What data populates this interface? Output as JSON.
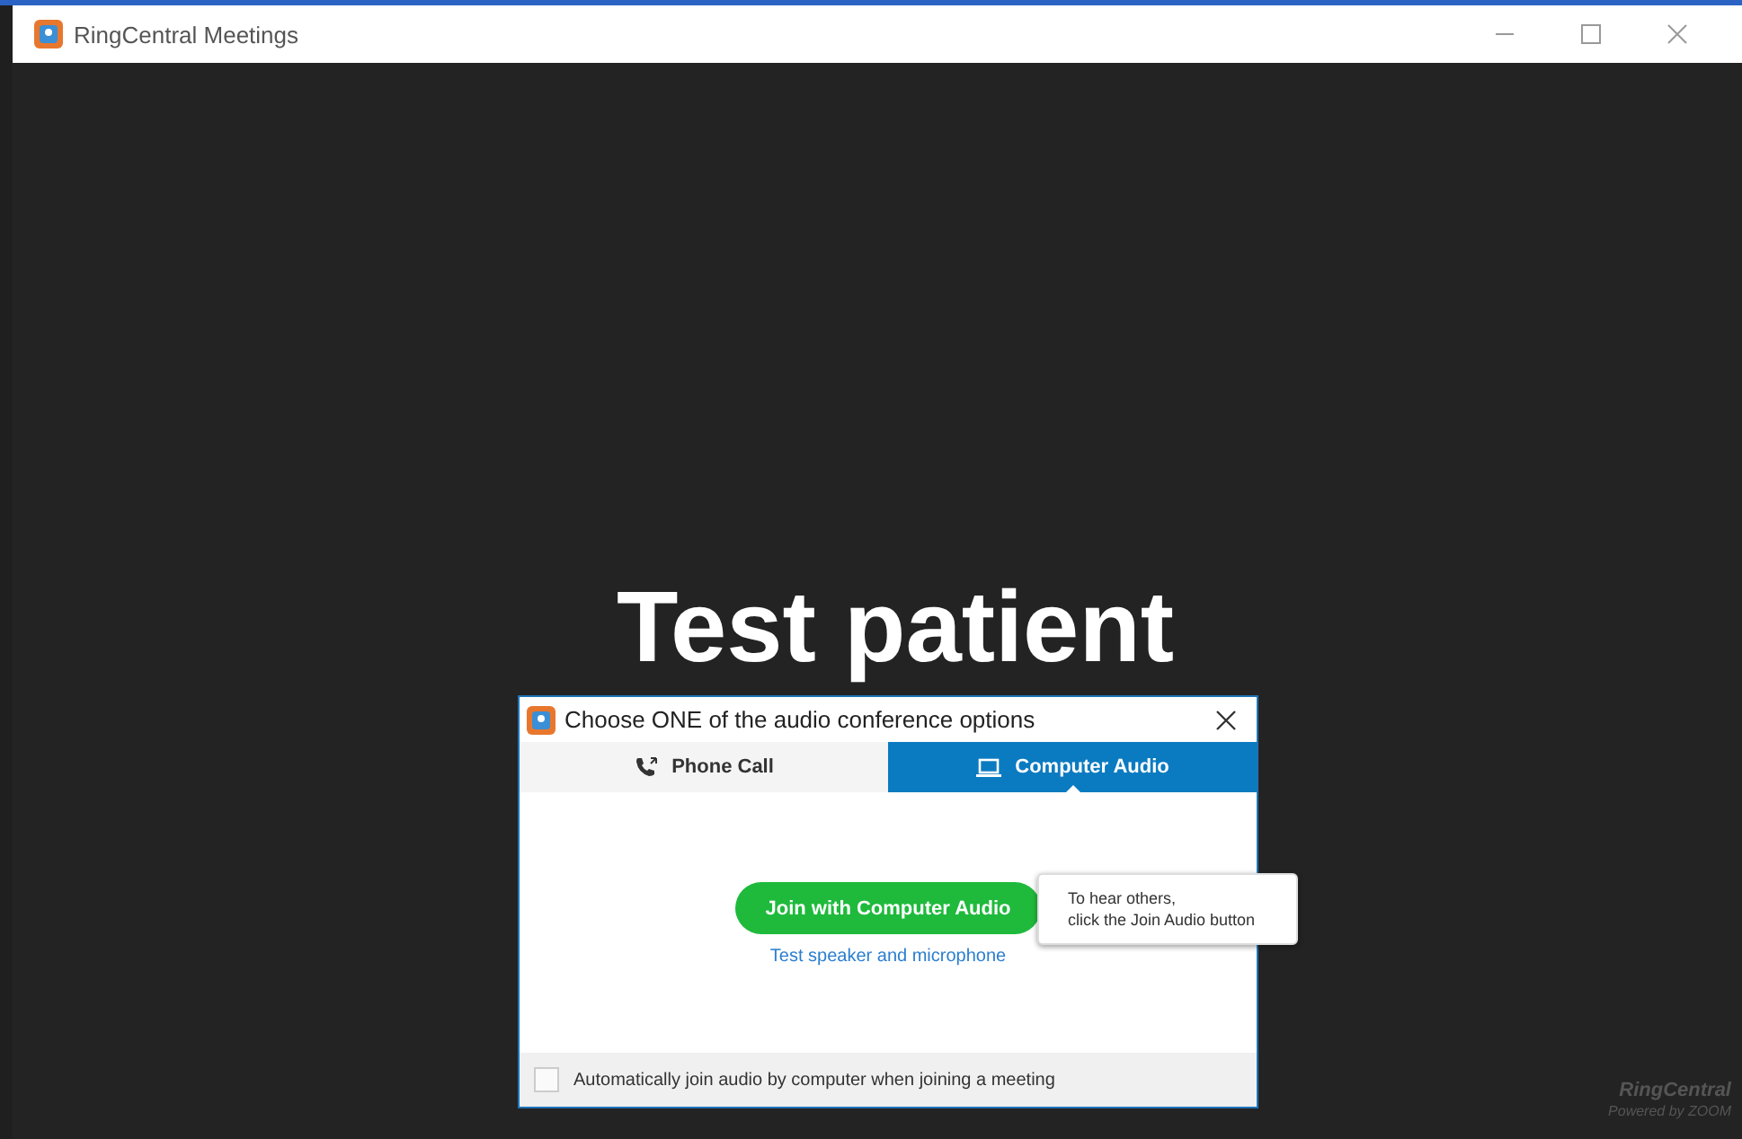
{
  "window": {
    "title": "RingCentral Meetings"
  },
  "meeting": {
    "name": "Test patient"
  },
  "dialog": {
    "title": "Choose ONE of the audio conference options",
    "tabs": [
      {
        "label": "Phone Call",
        "kind": "phone",
        "selected": false
      },
      {
        "label": "Computer Audio",
        "kind": "computer",
        "selected": true
      }
    ],
    "join_button": "Join with Computer Audio",
    "test_link": "Test speaker and microphone",
    "tooltip": [
      "To hear others,",
      "click the Join Audio button"
    ],
    "auto_join": {
      "label": "Automatically join audio by computer when joining a meeting",
      "checked": false
    }
  },
  "branding": {
    "name": "RingCentral",
    "powered_by": "Powered by ZOOM"
  }
}
